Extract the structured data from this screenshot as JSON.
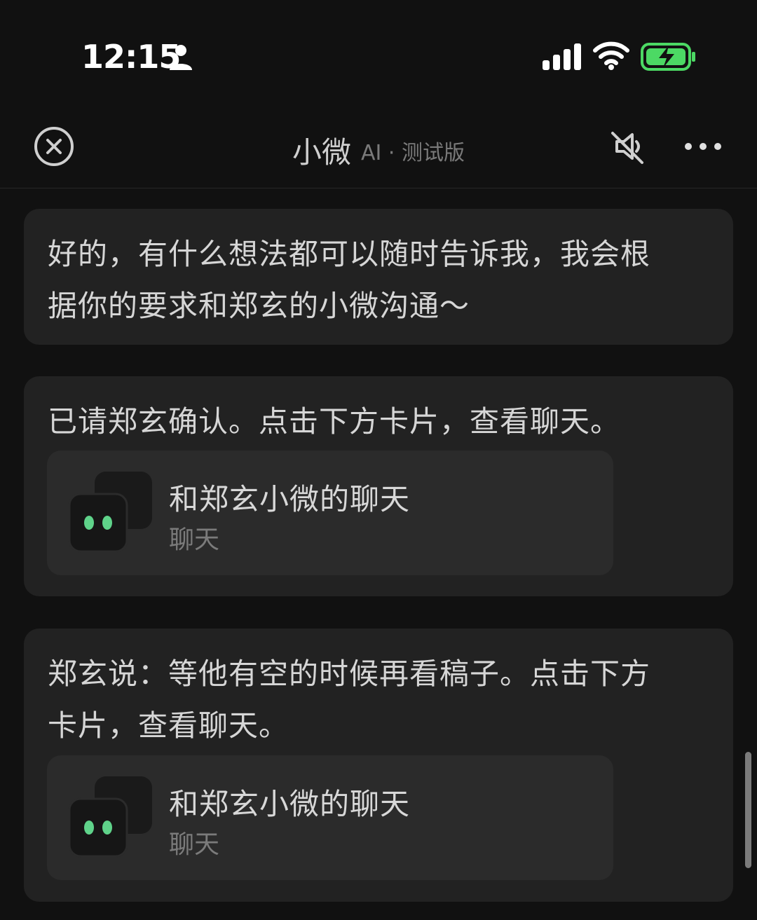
{
  "status_bar": {
    "time": "12:15",
    "icons": [
      "person-icon",
      "signal-icon",
      "wifi-icon",
      "battery-charging-icon"
    ],
    "battery_color": "#4cd964"
  },
  "nav": {
    "title": "小微",
    "subtitle": "AI · 测试版",
    "icons": [
      "close-icon",
      "mute-icon",
      "more-icon"
    ]
  },
  "messages": [
    {
      "text": "好的，有什么想法都可以随时告诉我，我会根\n据你的要求和郑玄的小微沟通～"
    },
    {
      "text": "已请郑玄确认。点击下方卡片，查看聊天。",
      "card": {
        "title": "和郑玄小微的聊天",
        "subtitle": "聊天"
      }
    },
    {
      "text": "郑玄说：等他有空的时候再看稿子。点击下方\n卡片，查看聊天。",
      "card": {
        "title": "和郑玄小微的聊天",
        "subtitle": "聊天"
      }
    }
  ],
  "colors": {
    "background": "#111111",
    "bubble": "#222222",
    "card": "#2b2b2b",
    "avatar_eyes": "#5fd38a"
  }
}
